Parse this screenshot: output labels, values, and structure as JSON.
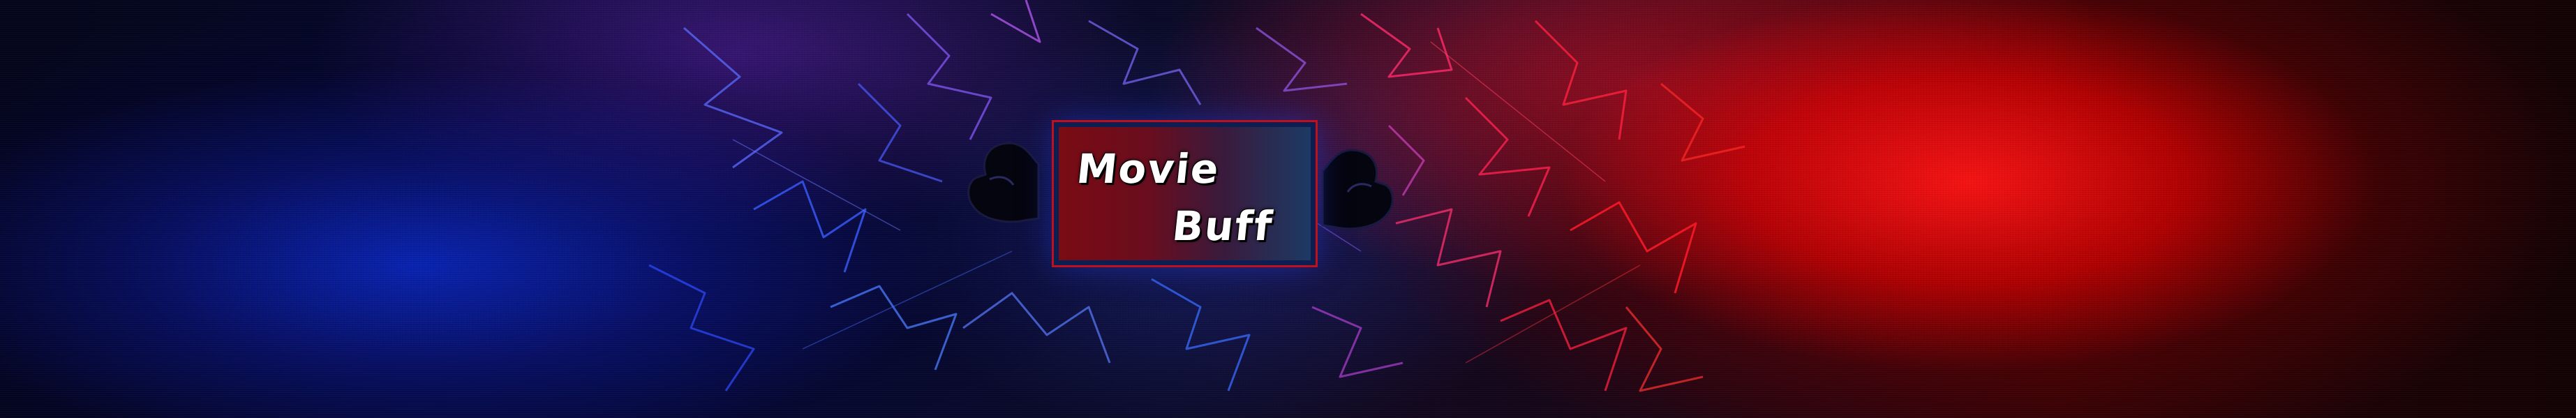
{
  "banner": {
    "logo": {
      "line_one": "Movie",
      "line_two": "Buff"
    },
    "colors": {
      "left_glow": "#1a2cd0",
      "right_glow": "#ff1414",
      "logo_border": "#0d1e52",
      "logo_outline": "#c0101c"
    },
    "icons": [
      "flexing-arm-left-icon",
      "flexing-arm-right-icon"
    ]
  }
}
